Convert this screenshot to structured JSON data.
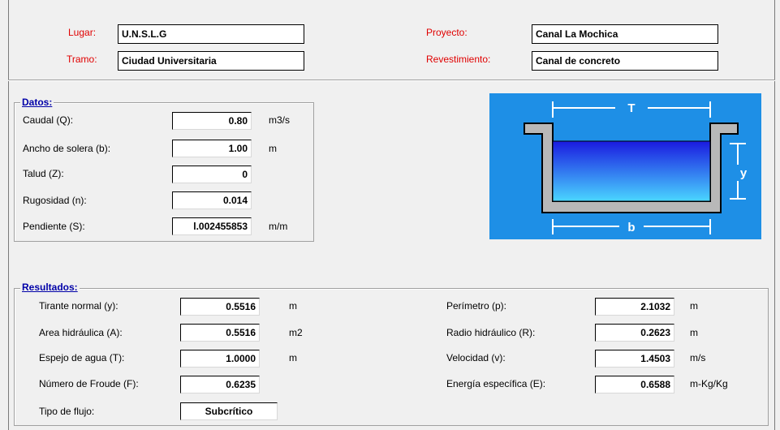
{
  "header": {
    "lugar_label": "Lugar:",
    "lugar_value": "U.N.S.L.G",
    "tramo_label": "Tramo:",
    "tramo_value": "Ciudad Universitaria",
    "proyecto_label": "Proyecto:",
    "proyecto_value": "Canal La Mochica",
    "revestimiento_label": "Revestimiento:",
    "revestimiento_value": "Canal de concreto"
  },
  "datos": {
    "title": "Datos:",
    "caudal_label": "Caudal (Q):",
    "caudal_value": "0.80",
    "caudal_unit": "m3/s",
    "ancho_label": "Ancho de solera (b):",
    "ancho_value": "1.00",
    "ancho_unit": "m",
    "talud_label": "Talud (Z):",
    "talud_value": "0",
    "rugosidad_label": "Rugosidad (n):",
    "rugosidad_value": "0.014",
    "pendiente_label": "Pendiente (S):",
    "pendiente_value": "l.002455853",
    "pendiente_unit": "m/m"
  },
  "diagram": {
    "label_t": "T",
    "label_y": "y",
    "label_b": "b",
    "bg_color": "#1e8fe6",
    "water_top": "#1a1ae0",
    "water_bottom": "#4ad6ff"
  },
  "resultados": {
    "title": "Resultados:",
    "tirante_label": "Tirante normal (y):",
    "tirante_value": "0.5516",
    "tirante_unit": "m",
    "area_label": "Area hidráulica (A):",
    "area_value": "0.5516",
    "area_unit": "m2",
    "espejo_label": "Espejo de agua (T):",
    "espejo_value": "1.0000",
    "espejo_unit": "m",
    "froude_label": "Número de Froude (F):",
    "froude_value": "0.6235",
    "tipo_label": "Tipo de flujo:",
    "tipo_value": "Subcrítico",
    "perimetro_label": "Perímetro (p):",
    "perimetro_value": "2.1032",
    "perimetro_unit": "m",
    "radio_label": "Radio hidráulico (R):",
    "radio_value": "0.2623",
    "radio_unit": "m",
    "velocidad_label": "Velocidad (v):",
    "velocidad_value": "1.4503",
    "velocidad_unit": "m/s",
    "energia_label": "Energía específica (E):",
    "energia_value": "0.6588",
    "energia_unit": "m-Kg/Kg"
  }
}
